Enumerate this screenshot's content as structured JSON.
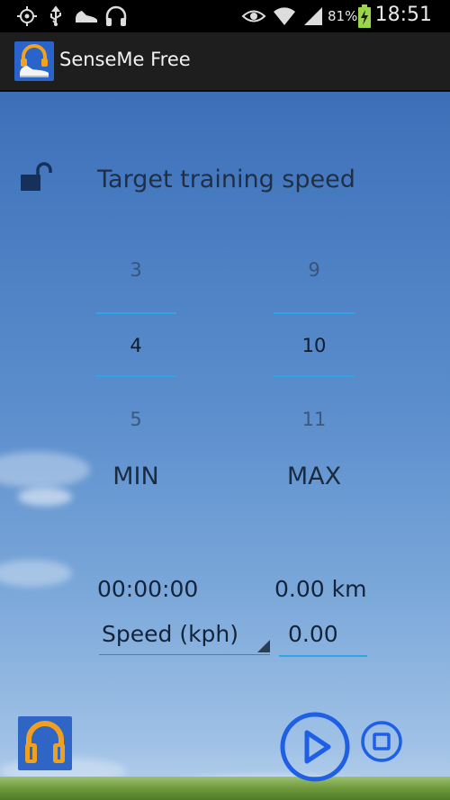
{
  "status_bar": {
    "icons": [
      "gps-icon",
      "usb-icon",
      "shoe-icon",
      "headphones-icon",
      "eye-icon",
      "wifi-icon",
      "signal-icon",
      "battery-charging-icon"
    ],
    "battery_percent": "81%",
    "time": "18:51"
  },
  "action_bar": {
    "app_icon": "senseme-app-icon",
    "title": "SenseMe Free"
  },
  "main": {
    "lock_icon": "unlock-icon",
    "heading": "Target training speed",
    "min_picker": {
      "prev": "3",
      "selected": "4",
      "next": "5",
      "label": "MIN"
    },
    "max_picker": {
      "prev": "9",
      "selected": "10",
      "next": "11",
      "label": "MAX"
    },
    "elapsed_time": "00:00:00",
    "distance": "0.00 km",
    "metric_dropdown": "Speed (kph)",
    "metric_value": "0.00"
  },
  "controls": {
    "headphones_icon": "headphones-icon",
    "play_icon": "play-icon",
    "stop_icon": "stop-icon"
  },
  "colors": {
    "accent": "#2fa4e6",
    "button_blue": "#1f5fe6",
    "sky_top": "#3d6fb8",
    "sky_bottom": "#b9d2ec"
  }
}
